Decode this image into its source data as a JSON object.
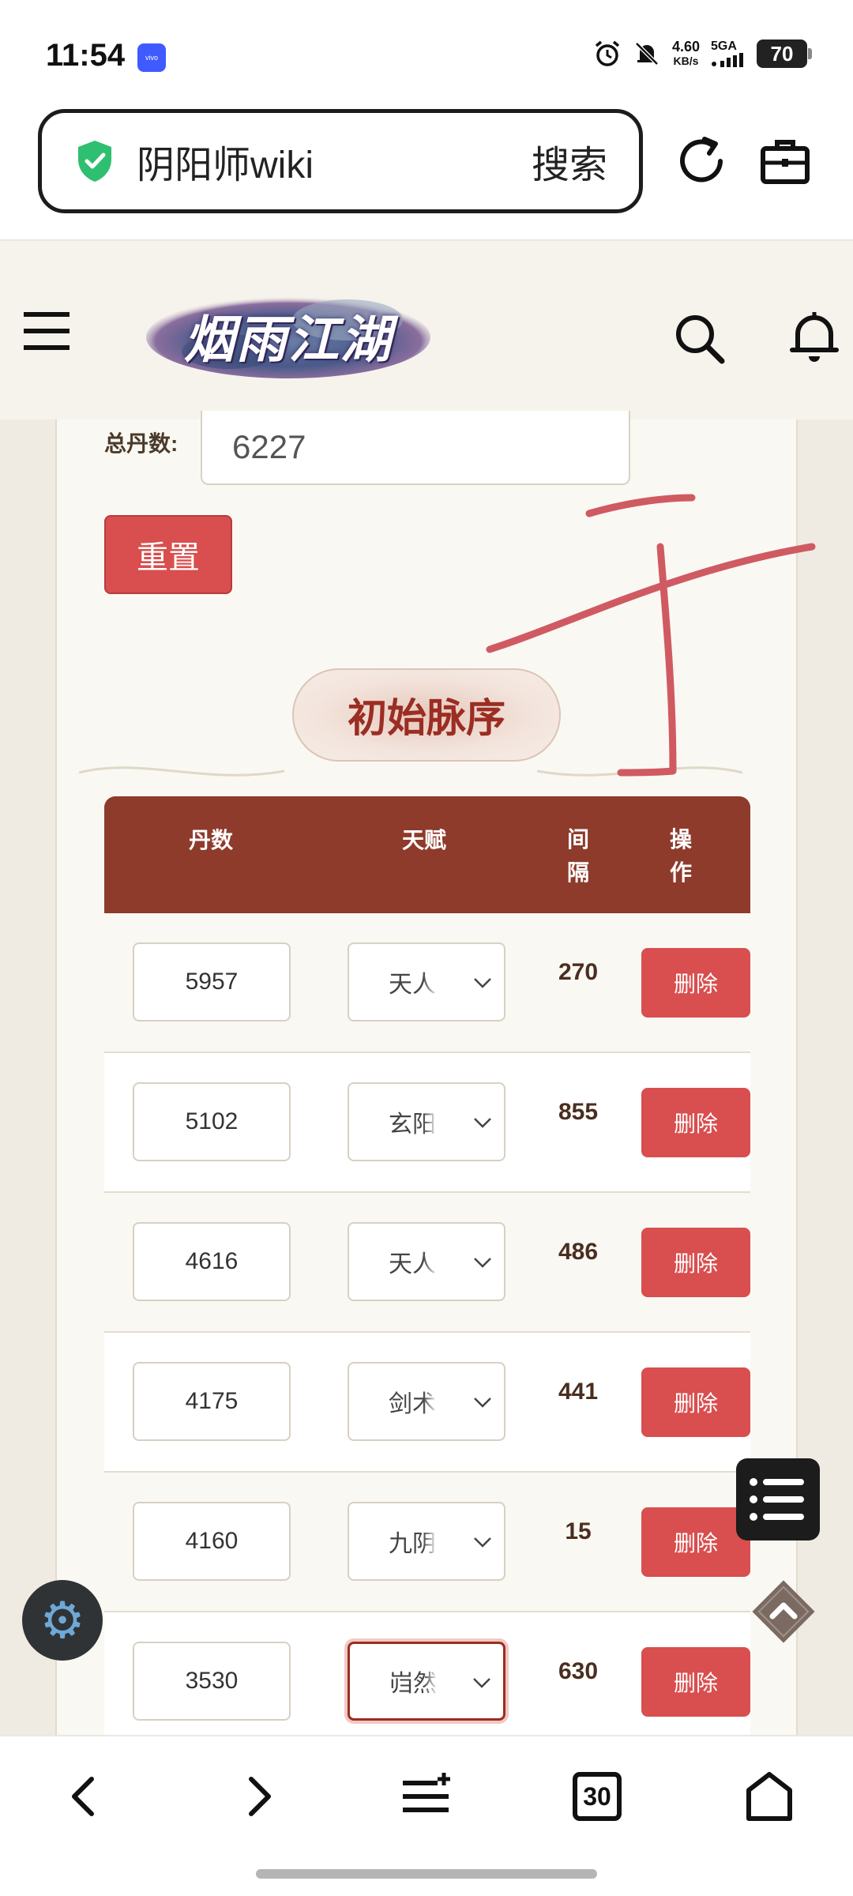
{
  "status_bar": {
    "time": "11:54",
    "vivo_badge": "vivo",
    "net_speed_value": "4.60",
    "net_speed_unit": "KB/s",
    "signal": "5GA",
    "battery": "70"
  },
  "browser": {
    "url_text": "阴阳师wiki",
    "search_label": "搜索"
  },
  "site": {
    "logo_text": "烟雨江湖"
  },
  "form": {
    "total_label": "总丹数:",
    "total_value": "6227",
    "reset_label": "重置"
  },
  "section": {
    "title": "初始脉序"
  },
  "table": {
    "headers": {
      "dan": "丹数",
      "tianfu": "天赋",
      "jiange": "间\n隔",
      "caozuo": "操\n作"
    },
    "rows": [
      {
        "dan": "5957",
        "tianfu": "天人",
        "gap": "270",
        "action": "删除"
      },
      {
        "dan": "5102",
        "tianfu": "玄阳",
        "gap": "855",
        "action": "删除"
      },
      {
        "dan": "4616",
        "tianfu": "天人",
        "gap": "486",
        "action": "删除"
      },
      {
        "dan": "4175",
        "tianfu": "剑术",
        "gap": "441",
        "action": "删除"
      },
      {
        "dan": "4160",
        "tianfu": "九阴",
        "gap": "15",
        "action": "删除"
      },
      {
        "dan": "3530",
        "tianfu": "岿然",
        "gap": "630",
        "action": "删除"
      }
    ]
  },
  "bottom_nav": {
    "tabs_count": "30"
  },
  "colors": {
    "accent_red": "#d94e4e",
    "table_header": "#8e3b2c",
    "section_title": "#9b2d22",
    "handwriting": "#d05a62"
  }
}
